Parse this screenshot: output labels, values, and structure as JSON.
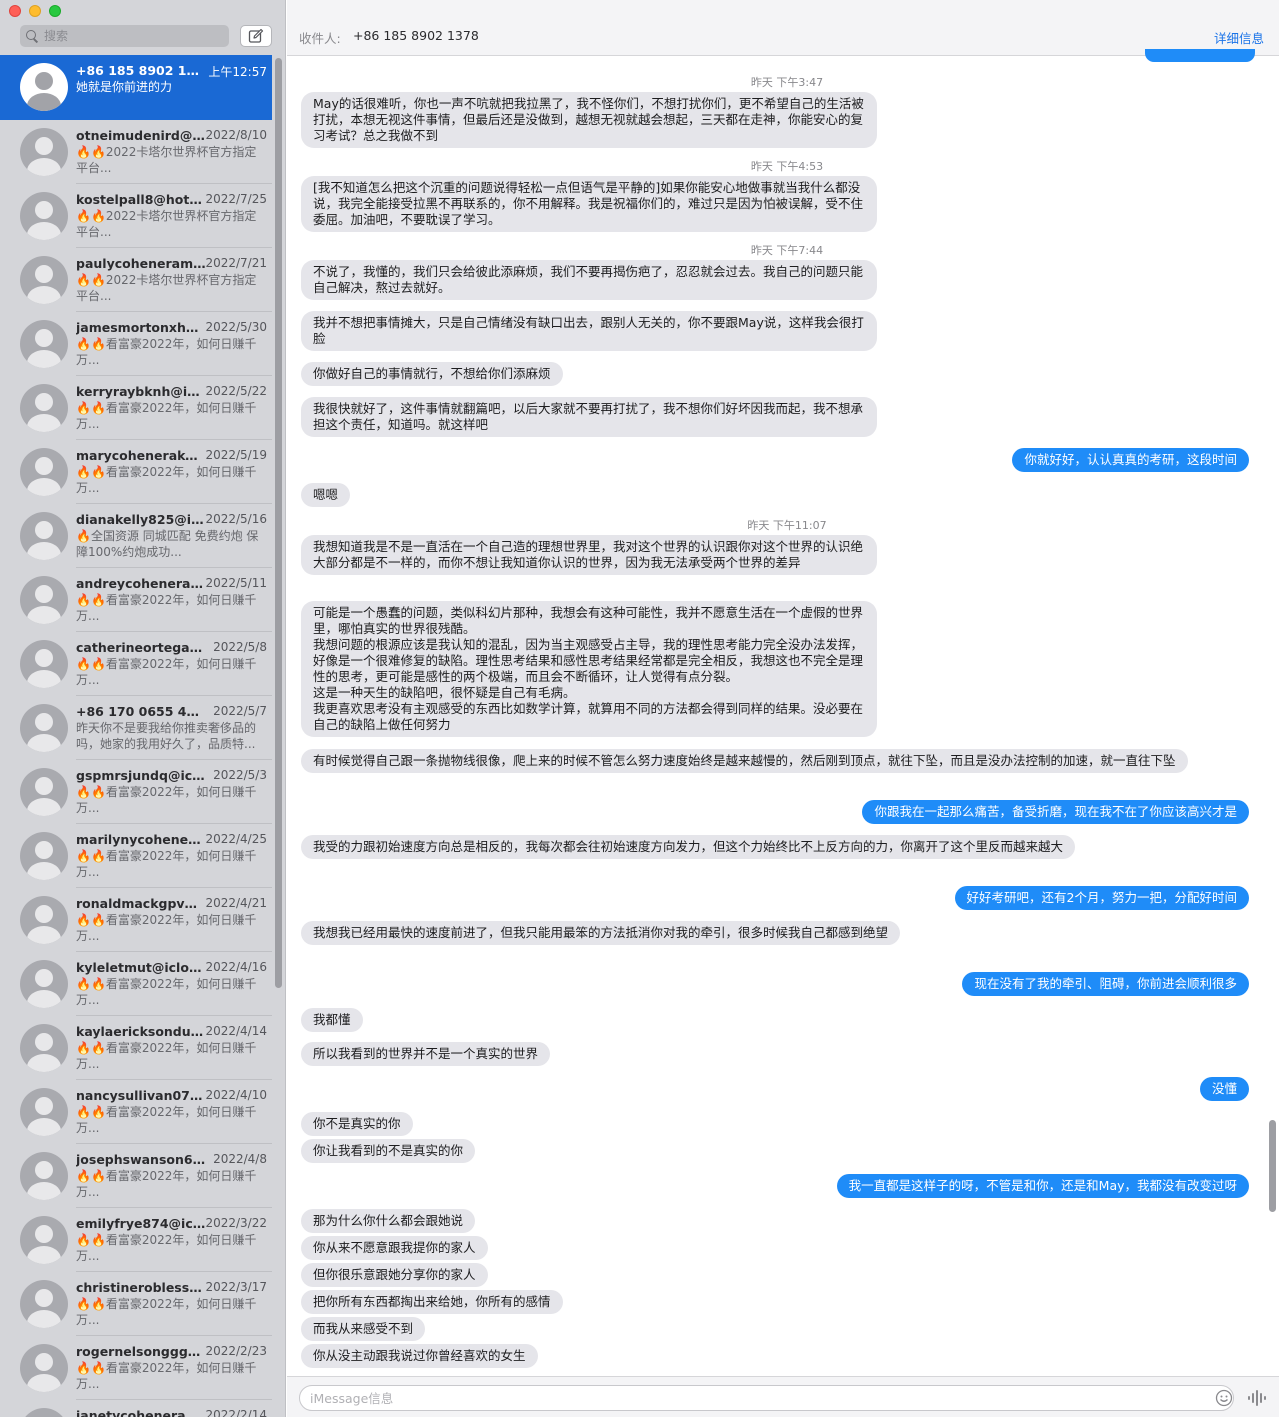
{
  "window": {
    "controls": [
      "close",
      "minimize",
      "zoom"
    ]
  },
  "sidebar": {
    "search": {
      "placeholder": "搜索",
      "icon": "search-icon"
    },
    "compose_icon": "compose-icon",
    "conversations": [
      {
        "name": "+86 185 8902 1378",
        "date": "上午12:57",
        "preview": "她就是你前进的力",
        "selected": true
      },
      {
        "name": "otneimudenird@ho...",
        "date": "2022/8/10",
        "preview": "🔥🔥2022卡塔尔世界杯官方指定平台..."
      },
      {
        "name": "kostelpall8@hotma...",
        "date": "2022/7/25",
        "preview": "🔥🔥2022卡塔尔世界杯官方指定平台..."
      },
      {
        "name": "paulycoheneramjgs...",
        "date": "2022/7/21",
        "preview": "🔥🔥2022卡塔尔世界杯官方指定平台..."
      },
      {
        "name": "jamesmortonxhej@...",
        "date": "2022/5/30",
        "preview": "🔥🔥看富豪2022年，如何日赚千万..."
      },
      {
        "name": "kerryraybknh@iclo...",
        "date": "2022/5/22",
        "preview": "🔥🔥看富豪2022年，如何日赚千万..."
      },
      {
        "name": "marycoheneraked...",
        "date": "2022/5/19",
        "preview": "🔥🔥看富豪2022年，如何日赚千万..."
      },
      {
        "name": "dianakelly825@iclo...",
        "date": "2022/5/16",
        "preview": "🔥全国资源 同城匹配 免费约炮 保障100%约炮成功..."
      },
      {
        "name": "andreycoheneranwi...",
        "date": "2022/5/11",
        "preview": "🔥🔥看富豪2022年，如何日赚千万..."
      },
      {
        "name": "catherineortegakjra...",
        "date": "2022/5/8",
        "preview": "🔥🔥看富豪2022年，如何日赚千万..."
      },
      {
        "name": "+86 170 0655 4097",
        "date": "2022/5/7",
        "preview": "昨天你不是要我给你推卖奢侈品的吗，她家的我用好久了，品质特..."
      },
      {
        "name": "gspmrsjundq@iclou...",
        "date": "2022/5/3",
        "preview": "🔥🔥看富豪2022年，如何日赚千万..."
      },
      {
        "name": "marilynycoheneray...",
        "date": "2022/4/25",
        "preview": "🔥🔥看富豪2022年，如何日赚千万..."
      },
      {
        "name": "ronaldmackgpv@icl...",
        "date": "2022/4/21",
        "preview": "🔥🔥看富豪2022年，如何日赚千万..."
      },
      {
        "name": "kyleletmut@icloud....",
        "date": "2022/4/16",
        "preview": "🔥🔥看富豪2022年，如何日赚千万..."
      },
      {
        "name": "kaylaericksondue@...",
        "date": "2022/4/14",
        "preview": "🔥🔥看富豪2022年，如何日赚千万..."
      },
      {
        "name": "nancysullivan0782...",
        "date": "2022/4/10",
        "preview": "🔥🔥看富豪2022年，如何日赚千万..."
      },
      {
        "name": "josephswanson687...",
        "date": "2022/4/8",
        "preview": "🔥🔥看富豪2022年，如何日赚千万..."
      },
      {
        "name": "emilyfrye874@iclo...",
        "date": "2022/3/22",
        "preview": "🔥🔥看富豪2022年，如何日赚千万..."
      },
      {
        "name": "christineroblesspo...",
        "date": "2022/3/17",
        "preview": "🔥🔥看富豪2022年，如何日赚千万..."
      },
      {
        "name": "rogernelsongggt@i...",
        "date": "2022/2/23",
        "preview": "🔥🔥看富豪2022年，如何日赚千万..."
      },
      {
        "name": "janetycoheneranr@...",
        "date": "2022/2/14",
        "preview": ""
      }
    ]
  },
  "header": {
    "to_label": "收件人:",
    "to_value": "+86 185 8902 1378",
    "details": "详细信息"
  },
  "messages": [
    {
      "type": "time",
      "text": "昨天 下午3:47"
    },
    {
      "type": "in",
      "text": "May的话很难听，你也一声不吭就把我拉黑了，我不怪你们，不想打扰你们，更不希望自己的生活被打扰，本想无视这件事情，但最后还是没做到，越想无视就越会想起，三天都在走神，你能安心的复习考试？总之我做不到"
    },
    {
      "type": "time",
      "text": "昨天 下午4:53"
    },
    {
      "type": "in",
      "text": "[我不知道怎么把这个沉重的问题说得轻松一点但语气是平静的]如果你能安心地做事就当我什么都没说，我完全能接受拉黑不再联系的，你不用解释。我是祝福你们的，难过只是因为怕被误解，受不住委屈。加油吧，不要耽误了学习。"
    },
    {
      "type": "time",
      "text": "昨天 下午7:44"
    },
    {
      "type": "in",
      "text": "不说了，我懂的，我们只会给彼此添麻烦，我们不要再揭伤疤了，忍忍就会过去。我自己的问题只能自己解决，熬过去就好。"
    },
    {
      "type": "in",
      "text": "我并不想把事情摊大，只是自己情绪没有缺口出去，跟别人无关的，你不要跟May说，这样我会很打脸"
    },
    {
      "type": "in",
      "text": "你做好自己的事情就行，不想给你们添麻烦"
    },
    {
      "type": "in",
      "text": "我很快就好了，这件事情就翻篇吧，以后大家就不要再打扰了，我不想你们好坏因我而起，我不想承担这个责任，知道吗。就这样吧"
    },
    {
      "type": "out",
      "text": "你就好好，认认真真的考研，这段时间"
    },
    {
      "type": "in",
      "text": "嗯嗯"
    },
    {
      "type": "time",
      "text": "昨天 下午11:07"
    },
    {
      "type": "in",
      "text": "我想知道我是不是一直活在一个自己造的理想世界里，我对这个世界的认识跟你对这个世界的认识绝大部分都是不一样的，而你不想让我知道你认识的世界，因为我无法承受两个世界的差异"
    },
    {
      "type": "in",
      "text": "可能是一个愚蠢的问题，类似科幻片那种，我想会有这种可能性，我并不愿意生活在一个虚假的世界里，哪怕真实的世界很残酷。\n我想问题的根源应该是我认知的混乱，因为当主观感受占主导，我的理性思考能力完全没办法发挥，好像是一个很难修复的缺陷。理性思考结果和感性思考结果经常都是完全相反，我想这也不完全是理性的思考，更可能是感性的两个极端，而且会不断循环，让人觉得有点分裂。\n这是一种天生的缺陷吧，很怀疑是自己有毛病。\n我更喜欢思考没有主观感受的东西比如数学计算，就算用不同的方法都会得到同样的结果。没必要在自己的缺陷上做任何努力"
    },
    {
      "type": "in",
      "text": "有时候觉得自己跟一条抛物线很像，爬上来的时候不管怎么努力速度始终是越来越慢的，然后刚到顶点，就往下坠，而且是没办法控制的加速，就一直往下坠"
    },
    {
      "type": "out",
      "text": "你跟我在一起那么痛苦，备受折磨，现在我不在了你应该高兴才是"
    },
    {
      "type": "in",
      "text": "我受的力跟初始速度方向总是相反的，我每次都会往初始速度方向发力，但这个力始终比不上反方向的力，你离开了这个里反而越来越大"
    },
    {
      "type": "out",
      "text": "好好考研吧，还有2个月，努力一把，分配好时间"
    },
    {
      "type": "in",
      "text": "我想我已经用最快的速度前进了，但我只能用最笨的方法抵消你对我的牵引，很多时候我自己都感到绝望"
    },
    {
      "type": "out",
      "text": "现在没有了我的牵引、阻碍，你前进会顺利很多"
    },
    {
      "type": "in",
      "text": "我都懂"
    },
    {
      "type": "in",
      "text": "所以我看到的世界并不是一个真实的世界"
    },
    {
      "type": "out",
      "text": "没懂"
    },
    {
      "type": "in",
      "text": "你不是真实的你"
    },
    {
      "type": "in",
      "text": "你让我看到的不是真实的你"
    },
    {
      "type": "out",
      "text": "我一直都是这样子的呀，不管是和你，还是和May，我都没有改变过呀"
    },
    {
      "type": "in",
      "text": "那为什么你什么都会跟她说"
    },
    {
      "type": "in",
      "text": "你从来不愿意跟我提你的家人"
    },
    {
      "type": "in",
      "text": "但你很乐意跟她分享你的家人"
    },
    {
      "type": "in",
      "text": "把你所有东西都掏出来给她，你所有的感情"
    },
    {
      "type": "in",
      "text": "而我从来感受不到"
    },
    {
      "type": "in",
      "text": "你从没主动跟我说过你曾经喜欢的女生"
    }
  ],
  "composer": {
    "placeholder": "iMessage信息",
    "emoji_icon": "emoji-icon",
    "audio_icon": "audio-waveform-icon"
  },
  "colors": {
    "accent": "#1a69d4",
    "outgoing_bubble": "#1f8cf8",
    "incoming_bubble": "#e5e5ea",
    "sidebar_bg": "#d4d5d9"
  }
}
